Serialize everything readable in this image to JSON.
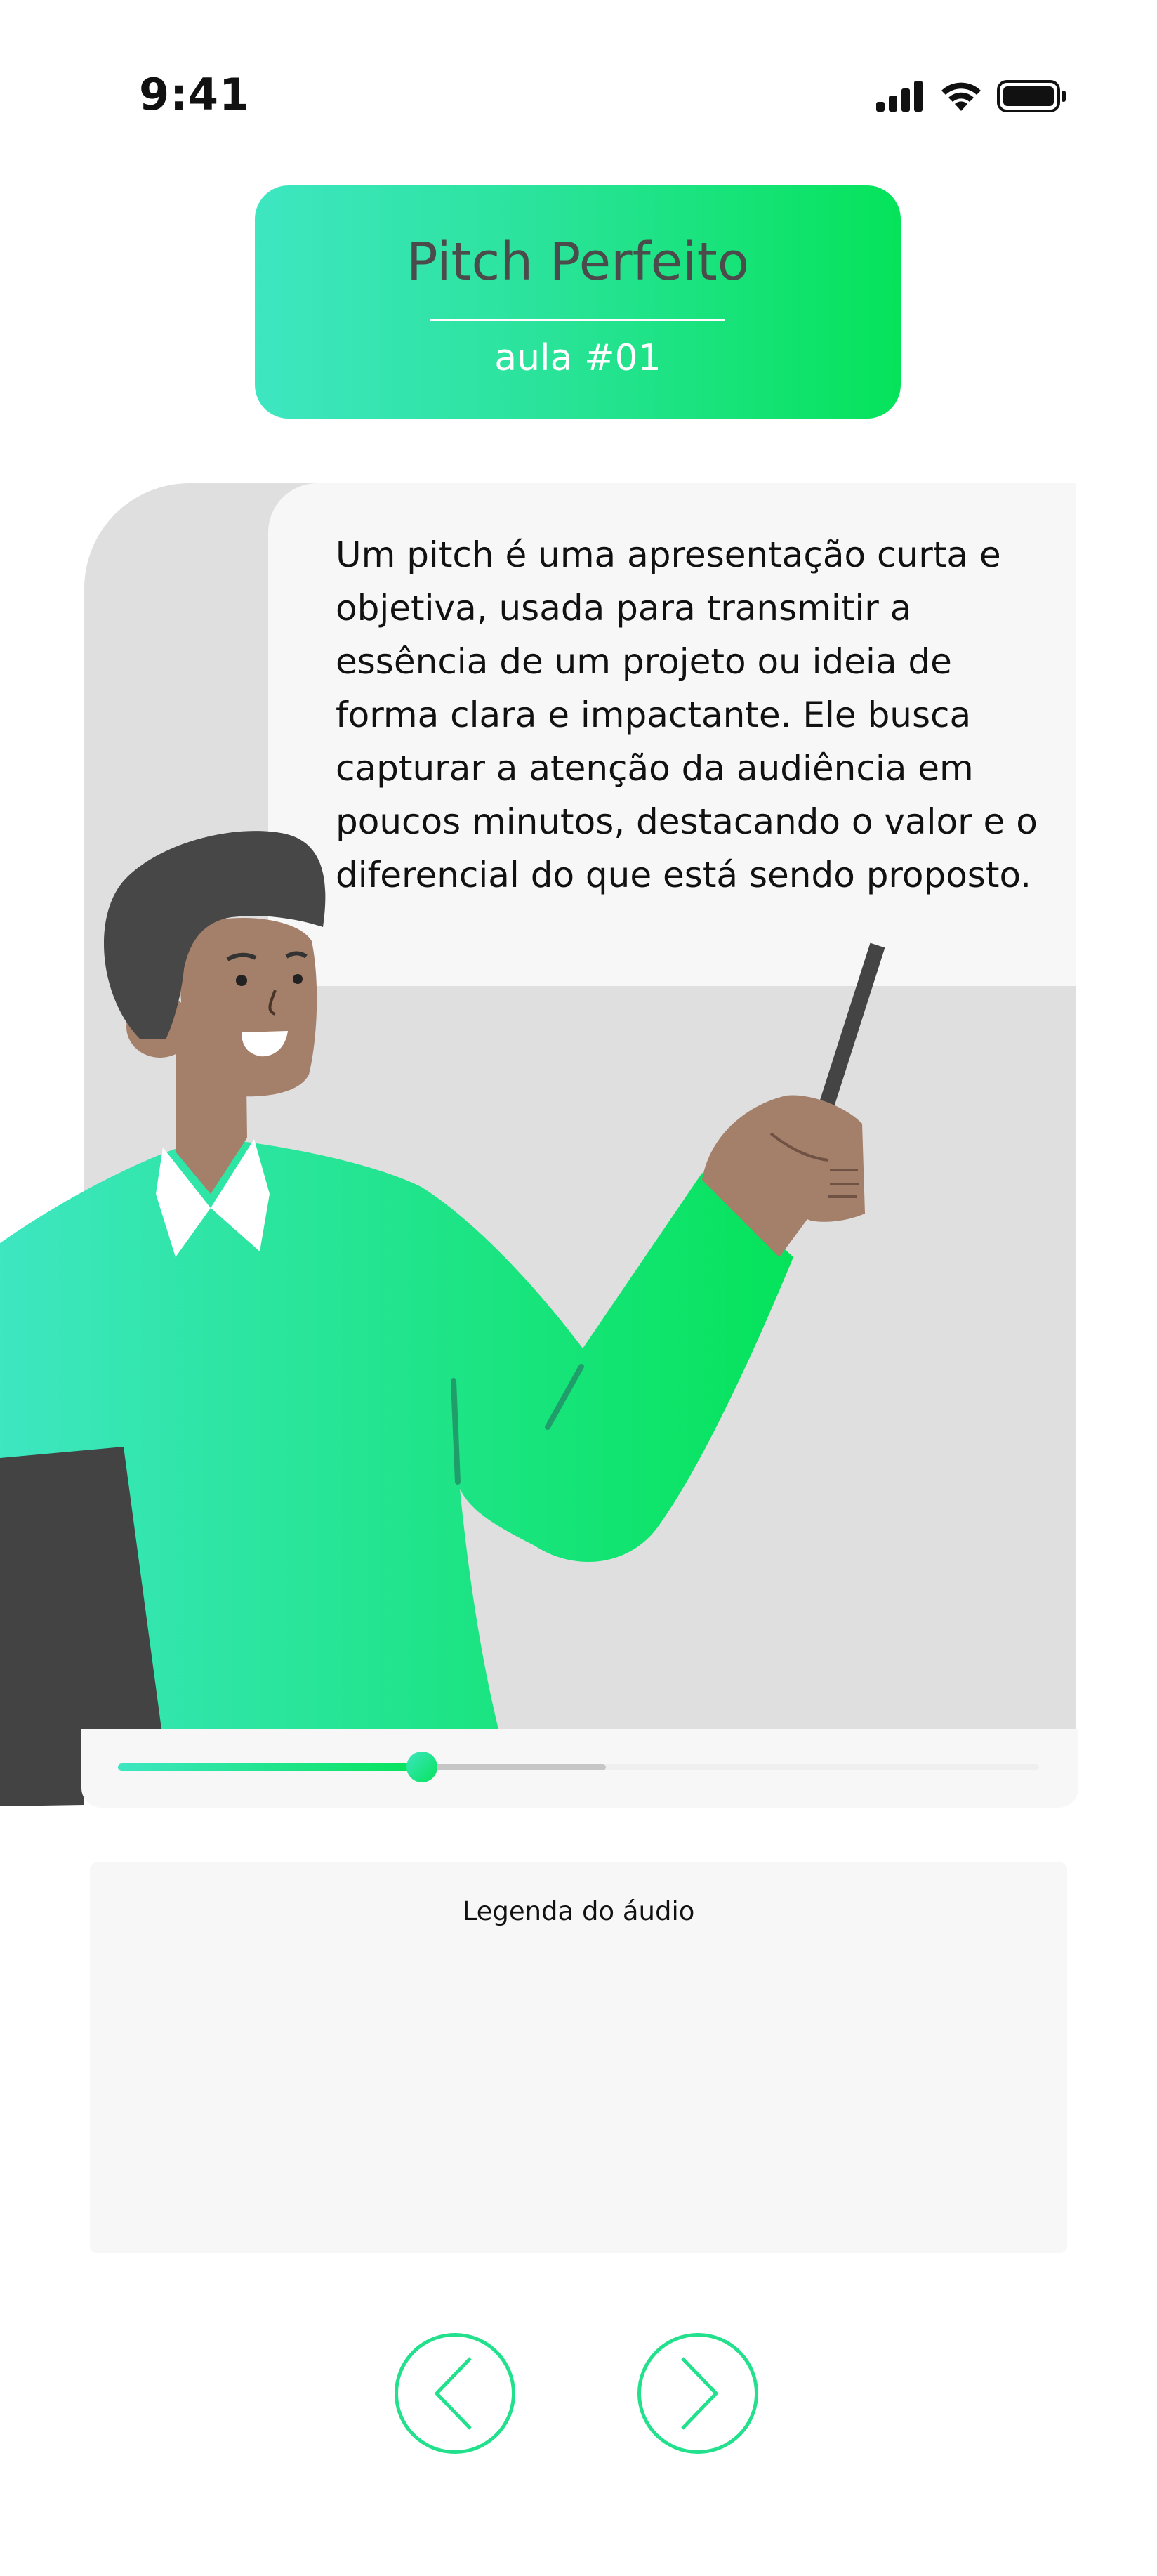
{
  "status_bar": {
    "time": "9:41",
    "icons": [
      "signal-icon",
      "wifi-icon",
      "battery-icon"
    ]
  },
  "lesson": {
    "title": "Pitch Perfeito",
    "subtitle": "aula #01"
  },
  "speech_bubble": {
    "text": "Um pitch é uma apresentação curta e objetiva, usada para transmitir a essência de um projeto ou ideia de forma clara e impactante. Ele busca capturar a atenção da audiência em poucos minutos, destacando o valor e o diferencial do que está sendo proposto."
  },
  "audio_player": {
    "progress": 0.33,
    "buffered": 0.53
  },
  "caption": {
    "label": "Legenda do áudio"
  },
  "navigation": {
    "prev_icon": "chevron-left-icon",
    "next_icon": "chevron-right-icon"
  },
  "colors": {
    "gradient_start": "#3EE6C1",
    "gradient_end": "#05E35A",
    "scene_bg": "#dfdfdf",
    "panel_bg": "#f7f7f7",
    "title_text": "#4b4b4b"
  }
}
